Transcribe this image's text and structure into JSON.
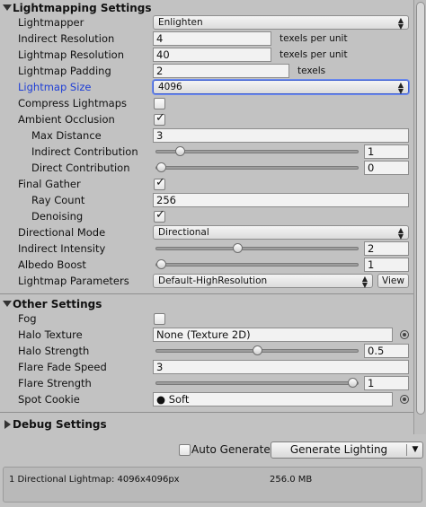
{
  "lightmapping": {
    "title": "Lightmapping Settings",
    "lightmapper": {
      "label": "Lightmapper",
      "value": "Enlighten"
    },
    "indirect_resolution": {
      "label": "Indirect Resolution",
      "value": "4",
      "suffix": "texels per unit"
    },
    "lightmap_resolution": {
      "label": "Lightmap Resolution",
      "value": "40",
      "suffix": "texels per unit"
    },
    "lightmap_padding": {
      "label": "Lightmap Padding",
      "value": "2",
      "suffix": "texels"
    },
    "lightmap_size": {
      "label": "Lightmap Size",
      "value": "4096"
    },
    "compress_lightmaps": {
      "label": "Compress Lightmaps",
      "checked": false
    },
    "ambient_occlusion": {
      "label": "Ambient Occlusion",
      "checked": true
    },
    "max_distance": {
      "label": "Max Distance",
      "value": "3"
    },
    "indirect_contribution": {
      "label": "Indirect Contribution",
      "value": "1",
      "slider_fraction": 0.1
    },
    "direct_contribution": {
      "label": "Direct Contribution",
      "value": "0",
      "slider_fraction": 0.0
    },
    "final_gather": {
      "label": "Final Gather",
      "checked": true
    },
    "ray_count": {
      "label": "Ray Count",
      "value": "256"
    },
    "denoising": {
      "label": "Denoising",
      "checked": true
    },
    "directional_mode": {
      "label": "Directional Mode",
      "value": "Directional"
    },
    "indirect_intensity": {
      "label": "Indirect Intensity",
      "value": "2",
      "slider_fraction": 0.4
    },
    "albedo_boost": {
      "label": "Albedo Boost",
      "value": "1",
      "slider_fraction": 0.0
    },
    "lightmap_parameters": {
      "label": "Lightmap Parameters",
      "value": "Default-HighResolution",
      "view_button": "View"
    }
  },
  "other": {
    "title": "Other Settings",
    "fog": {
      "label": "Fog",
      "checked": false
    },
    "halo_texture": {
      "label": "Halo Texture",
      "value": "None (Texture 2D)"
    },
    "halo_strength": {
      "label": "Halo Strength",
      "value": "0.5",
      "slider_fraction": 0.5
    },
    "flare_fade_speed": {
      "label": "Flare Fade Speed",
      "value": "3"
    },
    "flare_strength": {
      "label": "Flare Strength",
      "value": "1",
      "slider_fraction": 1.0
    },
    "spot_cookie": {
      "label": "Spot Cookie",
      "value": "Soft"
    }
  },
  "debug": {
    "title": "Debug Settings"
  },
  "footer": {
    "auto_generate": {
      "label": "Auto Generate",
      "checked": false
    },
    "generate_button": "Generate Lighting",
    "info_left": "1 Directional Lightmap: 4096x4096px",
    "info_right": "256.0 MB"
  }
}
